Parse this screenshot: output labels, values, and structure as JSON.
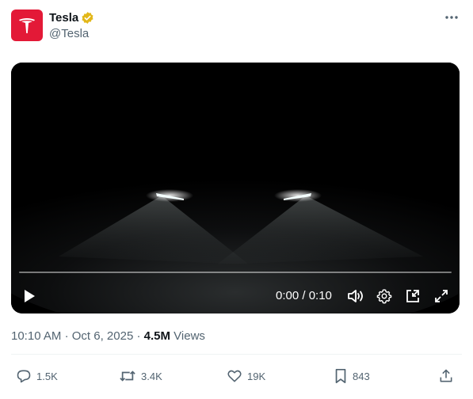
{
  "author": {
    "name": "Tesla",
    "handle": "@Tesla",
    "brand_color": "#e31937",
    "verified_color": "#e2b719"
  },
  "icons": {
    "avatar": "tesla-logo-icon",
    "verified": "verified-badge-icon",
    "more": "more-options-icon",
    "play": "play-icon",
    "volume": "volume-icon",
    "settings": "gear-icon",
    "pip": "picture-in-picture-icon",
    "fullscreen": "fullscreen-icon",
    "reply": "reply-icon",
    "repost": "repost-icon",
    "like": "heart-icon",
    "bookmark": "bookmark-icon",
    "share": "share-icon"
  },
  "video": {
    "time_display": "0:00 / 0:10",
    "progress": 0
  },
  "meta": {
    "time": "10:10 AM",
    "separator1": "·",
    "date": "Oct 6, 2025",
    "separator2": "·",
    "views_count": "4.5M",
    "views_label": "Views"
  },
  "actions": {
    "replies": "1.5K",
    "reposts": "3.4K",
    "likes": "19K",
    "bookmarks": "843"
  }
}
